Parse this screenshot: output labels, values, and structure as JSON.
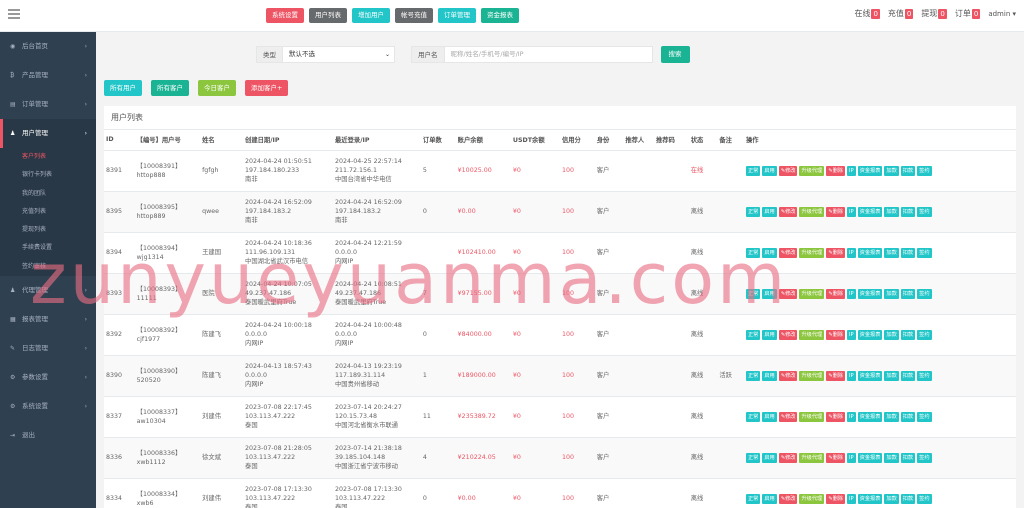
{
  "topbar": {
    "buttons": [
      {
        "label": "系统设置",
        "color": "#ed5565"
      },
      {
        "label": "用户列表",
        "color": "#676a6c"
      },
      {
        "label": "增加用户",
        "color": "#23c6c8"
      },
      {
        "label": "帐号充值",
        "color": "#676a6c"
      },
      {
        "label": "订单管理",
        "color": "#23c6c8"
      },
      {
        "label": "资金报表",
        "color": "#1ab394"
      }
    ],
    "stats": [
      {
        "label": "在线",
        "count": "0"
      },
      {
        "label": "充值",
        "count": "0"
      },
      {
        "label": "提现",
        "count": "0"
      },
      {
        "label": "订单",
        "count": "0"
      }
    ],
    "user": "admin"
  },
  "sidebar": {
    "items": [
      {
        "label": "后台首页",
        "icon": "dashboard-icon"
      },
      {
        "label": "产品管理",
        "icon": "bitcoin-icon"
      },
      {
        "label": "订单管理",
        "icon": "file-icon"
      },
      {
        "label": "用户管理",
        "icon": "user-icon"
      }
    ],
    "subitems": [
      "客户列表",
      "银行卡列表",
      "我的团队",
      "充值列表",
      "提现列表",
      "手续费设置",
      "签约审核"
    ],
    "items2": [
      {
        "label": "代理管理",
        "icon": "user-icon"
      },
      {
        "label": "报表管理",
        "icon": "chart-icon"
      },
      {
        "label": "日志管理",
        "icon": "log-icon"
      },
      {
        "label": "参数设置",
        "icon": "gear-icon"
      },
      {
        "label": "系统设置",
        "icon": "gears-icon"
      },
      {
        "label": "退出",
        "icon": "logout-icon"
      }
    ]
  },
  "filter": {
    "type_label": "类型",
    "type_value": "默认不选",
    "username_label": "用户名",
    "search_placeholder": "昵称/姓名/手机号/编号/IP",
    "search_button": "搜索"
  },
  "quick_buttons": [
    {
      "label": "所有用户",
      "color": "#23c6c8"
    },
    {
      "label": "所有客户",
      "color": "#1ab394"
    },
    {
      "label": "今日客户",
      "color": "#8cc63e"
    },
    {
      "label": "添加客户+",
      "color": "#ed5565"
    }
  ],
  "panel_title": "用户列表",
  "columns": [
    "ID",
    "【编号】用户号",
    "姓名",
    "创建日期/IP",
    "最近登录/IP",
    "订单数",
    "账户余额",
    "USDT余额",
    "信用分",
    "身份",
    "推荐人",
    "推荐码",
    "状态",
    "备注",
    "操作"
  ],
  "rows": [
    {
      "id": "8391",
      "code": "【10008391】",
      "uname": "httop888",
      "name": "fgfgh",
      "created": "2024-04-24 01:50:51",
      "created_ip": "197.184.180.233",
      "created_loc": "南非",
      "login": "2024-04-25 22:57:14",
      "login_ip": "211.72.156.1",
      "login_loc": "中国台湾省中华电信",
      "orders": "5",
      "balance": "¥10025.00",
      "usdt": "¥0",
      "credit": "100",
      "role": "客户",
      "ref": "",
      "refcode": "",
      "status": "在线",
      "note": ""
    },
    {
      "id": "8395",
      "code": "【10008395】",
      "uname": "httop889",
      "name": "qwee",
      "created": "2024-04-24 16:52:09",
      "created_ip": "197.184.183.2",
      "created_loc": "南非",
      "login": "2024-04-24 16:52:09",
      "login_ip": "197.184.183.2",
      "login_loc": "南非",
      "orders": "0",
      "balance": "¥0.00",
      "usdt": "¥0",
      "credit": "100",
      "role": "客户",
      "ref": "",
      "refcode": "",
      "status": "离线",
      "note": ""
    },
    {
      "id": "8394",
      "code": "【10008394】",
      "uname": "wjg1314",
      "name": "王建国",
      "created": "2024-04-24 10:18:36",
      "created_ip": "111.96.109.131",
      "created_loc": "中国湖北省武汉市电信",
      "login": "2024-04-24 12:21:59",
      "login_ip": "0.0.0.0",
      "login_loc": "内网IP",
      "orders": "",
      "balance": "¥102410.00",
      "usdt": "¥0",
      "credit": "100",
      "role": "客户",
      "ref": "",
      "refcode": "",
      "status": "离线",
      "note": ""
    },
    {
      "id": "8393",
      "code": "【10008393】",
      "uname": "11111",
      "name": "医院",
      "created": "2024-04-24 10:07:05",
      "created_ip": "49.237.47.186",
      "created_loc": "泰国暖武里府True",
      "login": "2024-04-24 10:08:51",
      "login_ip": "49.237.47.186",
      "login_loc": "泰国暖武里府True",
      "orders": "7",
      "balance": "¥97155.00",
      "usdt": "¥0",
      "credit": "100",
      "role": "客户",
      "ref": "",
      "refcode": "",
      "status": "离线",
      "note": ""
    },
    {
      "id": "8392",
      "code": "【10008392】",
      "uname": "cjf1977",
      "name": "陈建飞",
      "created": "2024-04-24 10:00:18",
      "created_ip": "0.0.0.0",
      "created_loc": "内网IP",
      "login": "2024-04-24 10:00:48",
      "login_ip": "0.0.0.0",
      "login_loc": "内网IP",
      "orders": "0",
      "balance": "¥84000.00",
      "usdt": "¥0",
      "credit": "100",
      "role": "客户",
      "ref": "",
      "refcode": "",
      "status": "离线",
      "note": ""
    },
    {
      "id": "8390",
      "code": "【10008390】",
      "uname": "520520",
      "name": "陈建飞",
      "created": "2024-04-13 18:57:43",
      "created_ip": "0.0.0.0",
      "created_loc": "内网IP",
      "login": "2024-04-13 19:23:19",
      "login_ip": "117.189.31.114",
      "login_loc": "中国贵州省移动",
      "orders": "1",
      "balance": "¥189000.00",
      "usdt": "¥0",
      "credit": "100",
      "role": "客户",
      "ref": "",
      "refcode": "",
      "status": "离线",
      "note": "活跃"
    },
    {
      "id": "8337",
      "code": "【10008337】",
      "uname": "aw10304",
      "name": "刘建伟",
      "created": "2023-07-08 22:17:45",
      "created_ip": "103.113.47.222",
      "created_loc": "泰国",
      "login": "2023-07-14 20:24:27",
      "login_ip": "120.15.73.48",
      "login_loc": "中国河北省衡水市联通",
      "orders": "11",
      "balance": "¥235389.72",
      "usdt": "¥0",
      "credit": "100",
      "role": "客户",
      "ref": "",
      "refcode": "",
      "status": "离线",
      "note": ""
    },
    {
      "id": "8336",
      "code": "【10008336】",
      "uname": "xwb1112",
      "name": "徐文斌",
      "created": "2023-07-08 21:28:05",
      "created_ip": "103.113.47.222",
      "created_loc": "泰国",
      "login": "2023-07-14 21:38:18",
      "login_ip": "39.185.104.148",
      "login_loc": "中国浙江省宁波市移动",
      "orders": "4",
      "balance": "¥210224.05",
      "usdt": "¥0",
      "credit": "100",
      "role": "客户",
      "ref": "",
      "refcode": "",
      "status": "离线",
      "note": ""
    },
    {
      "id": "8334",
      "code": "【10008334】",
      "uname": "xwb6",
      "name": "刘建伟",
      "created": "2023-07-08 17:13:30",
      "created_ip": "103.113.47.222",
      "created_loc": "泰国",
      "login": "2023-07-08 17:13:30",
      "login_ip": "103.113.47.222",
      "login_loc": "泰国",
      "orders": "0",
      "balance": "¥0.00",
      "usdt": "¥0",
      "credit": "100",
      "role": "客户",
      "ref": "",
      "refcode": "",
      "status": "离线",
      "note": ""
    }
  ],
  "row_actions": [
    {
      "label": "正常",
      "cls": "t"
    },
    {
      "label": "启用",
      "cls": "t"
    },
    {
      "label": "✎修改",
      "cls": "r"
    },
    {
      "label": "升级代理",
      "cls": "y"
    },
    {
      "label": "✎删除",
      "cls": "r"
    },
    {
      "label": "IP",
      "cls": "t"
    },
    {
      "label": "资金报表",
      "cls": "t"
    },
    {
      "label": "加款",
      "cls": "t"
    },
    {
      "label": "扣款",
      "cls": "t"
    },
    {
      "label": "签约",
      "cls": "t"
    }
  ],
  "watermark": "zunyueyuanma.com"
}
